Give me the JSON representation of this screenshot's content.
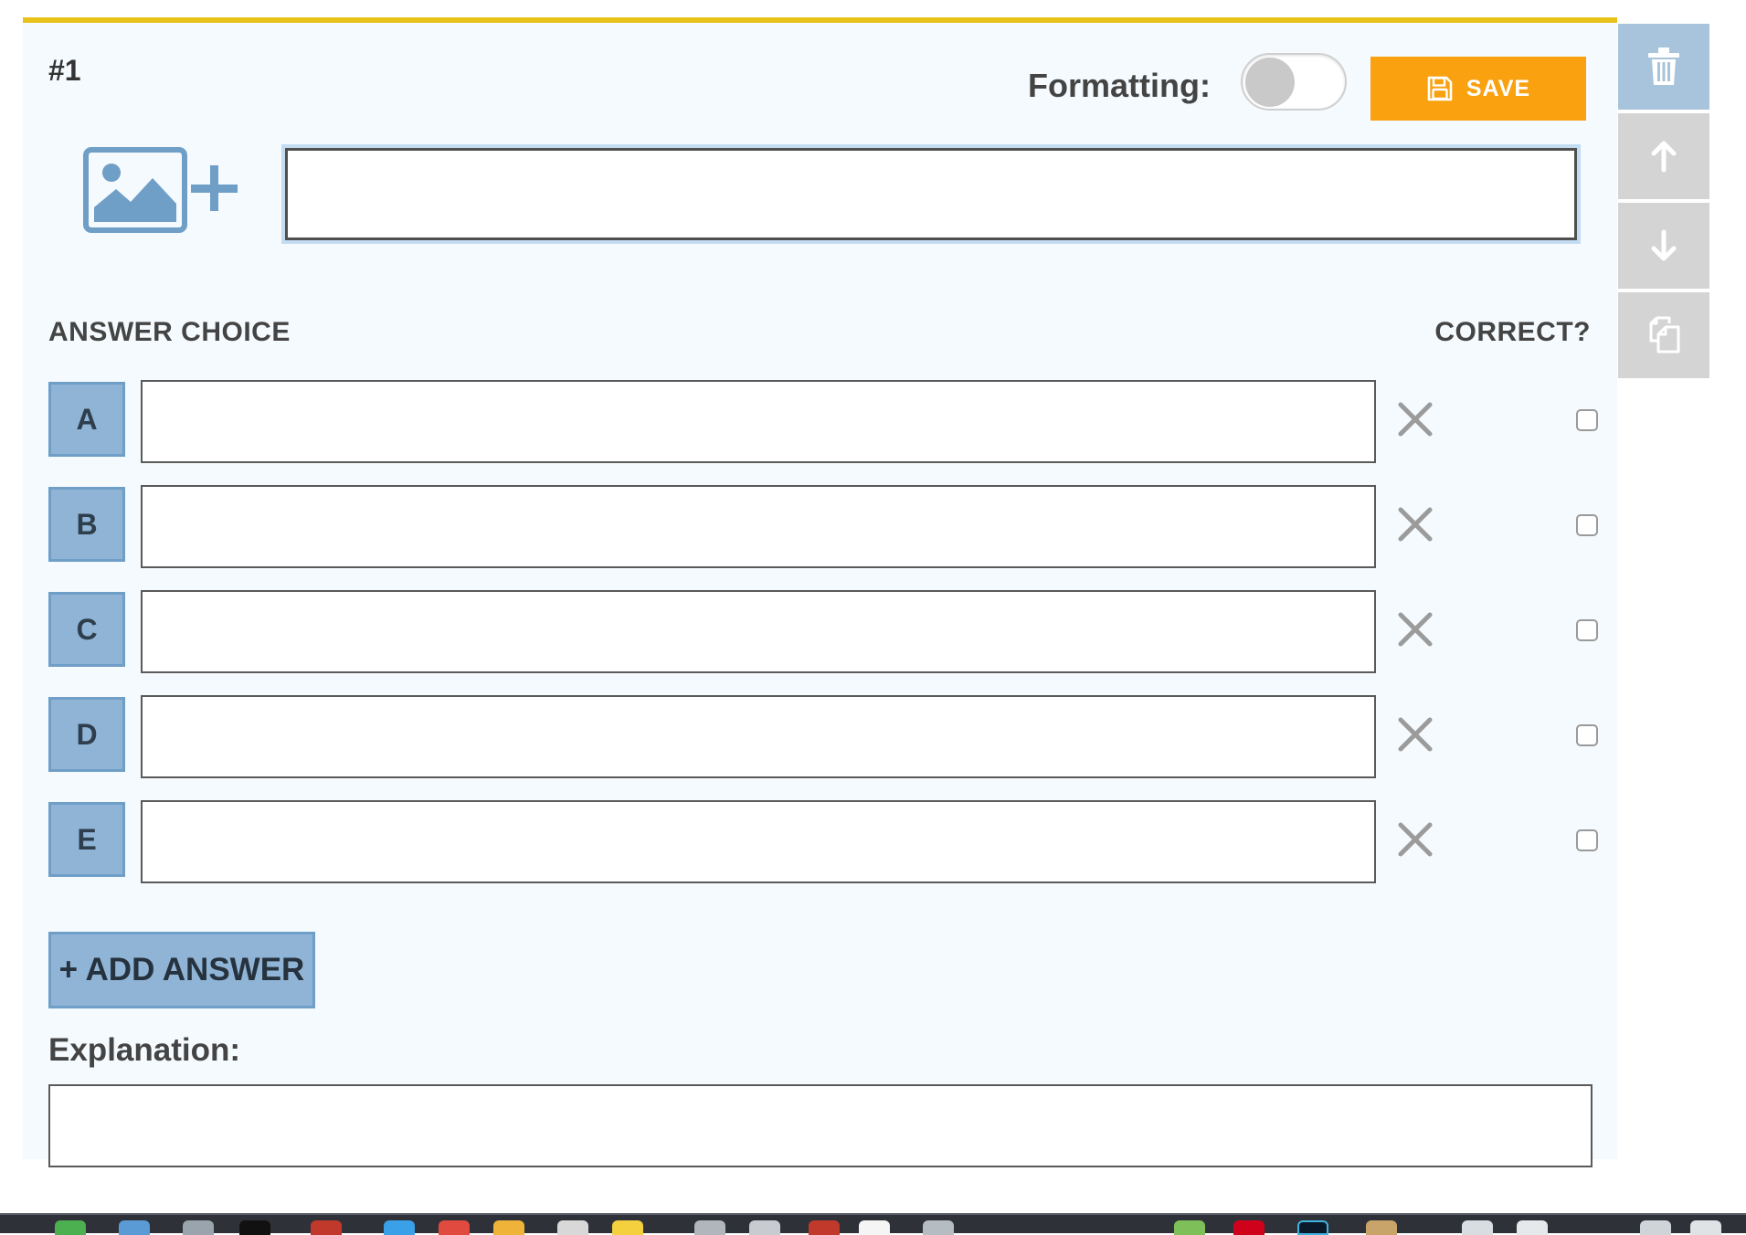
{
  "question": {
    "number": "#1",
    "input_value": "",
    "input_placeholder": ""
  },
  "toolbar": {
    "formatting_label": "Formatting:",
    "formatting_enabled": false,
    "save_label": "SAVE",
    "save_icon": "floppy-disk-icon",
    "add_image_icon": "image-plus-icon"
  },
  "columns": {
    "answer_choice": "ANSWER CHOICE",
    "correct": "CORRECT?"
  },
  "answers": [
    {
      "letter": "A",
      "value": "",
      "correct": false
    },
    {
      "letter": "B",
      "value": "",
      "correct": false
    },
    {
      "letter": "C",
      "value": "",
      "correct": false
    },
    {
      "letter": "D",
      "value": "",
      "correct": false
    },
    {
      "letter": "E",
      "value": "",
      "correct": false
    }
  ],
  "add_answer_label": "+ ADD ANSWER",
  "explanation": {
    "label": "Explanation:",
    "value": ""
  },
  "side_actions": [
    {
      "name": "delete",
      "icon": "trash-icon"
    },
    {
      "name": "move-up",
      "icon": "arrow-up-icon"
    },
    {
      "name": "move-down",
      "icon": "arrow-down-icon"
    },
    {
      "name": "duplicate",
      "icon": "copy-icon"
    }
  ],
  "colors": {
    "accent_bar": "#e8c21b",
    "save_button": "#f9a10e",
    "letter_badge": "#8fb4d6",
    "card_background": "#f4fafd"
  }
}
